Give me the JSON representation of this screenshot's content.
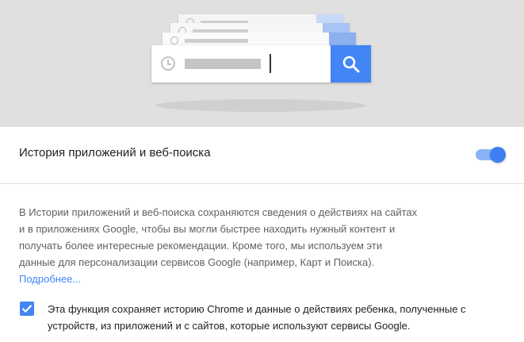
{
  "illustration": {
    "search_icon": "search-icon",
    "history_icon": "clock-icon"
  },
  "setting": {
    "title": "История приложений и веб-поиска",
    "enabled": true
  },
  "description": {
    "lines": [
      "В Истории приложений и веб-поиска сохраняются сведения о действиях на сайтах",
      "и в приложениях Google, чтобы вы могли быстрее находить нужный контент и",
      "получать более интересные рекомендации. Кроме того, мы используем эти",
      "данные для персонализации сервисов Google (например, Карт и Поиска)."
    ],
    "learn_more": "Подробнее..."
  },
  "chrome_option": {
    "checked": true,
    "lines": [
      "Эта функция сохраняет историю Chrome и данные о действиях ребенка, полученные с",
      "устройств, из приложений и с сайтов, которые используют сервисы Google."
    ]
  },
  "colors": {
    "accent": "#4285f4",
    "hero_background": "#e0e0e0",
    "body_text": "#616161"
  }
}
